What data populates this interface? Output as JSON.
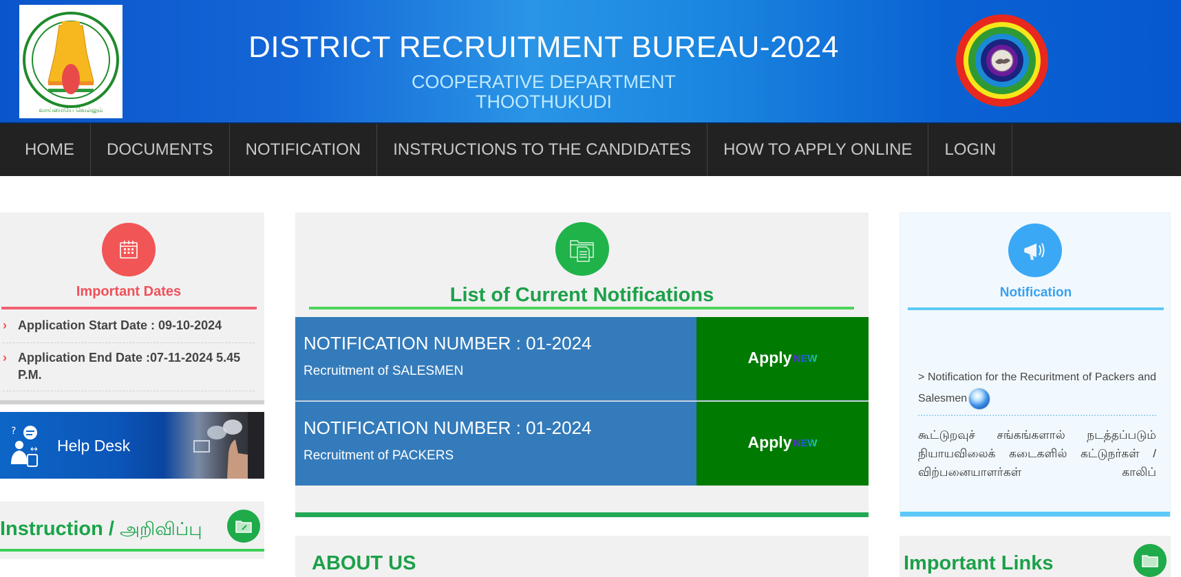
{
  "header": {
    "title": "DISTRICT RECRUITMENT BUREAU-2024",
    "department": "COOPERATIVE DEPARTMENT",
    "district": "THOOTHUKUDI",
    "left_logo": "tamil-nadu-emblem",
    "right_logo": "cooperative-rainbow-logo"
  },
  "nav": {
    "items": [
      {
        "label": "HOME"
      },
      {
        "label": "DOCUMENTS"
      },
      {
        "label": "NOTIFICATION"
      },
      {
        "label": "INSTRUCTIONS TO THE CANDIDATES"
      },
      {
        "label": "HOW TO APPLY ONLINE"
      },
      {
        "label": "LOGIN"
      }
    ]
  },
  "important_dates": {
    "icon": "calendar-icon",
    "title": "Important Dates",
    "items": [
      {
        "text": "Application Start Date : 09-10-2024"
      },
      {
        "text": "Application End Date :07-11-2024 5.45 P.M."
      }
    ],
    "bullet": "›"
  },
  "helpdesk": {
    "label": "Help Desk"
  },
  "instruction": {
    "title": "Instruction / ",
    "title_tamil": "அறிவிப்பு",
    "icon": "folder-icon"
  },
  "notifications": {
    "icon": "folder-document-icon",
    "title": "List of Current Notifications",
    "rows": [
      {
        "number": "NOTIFICATION NUMBER : 01-2024",
        "description": "Recruitment of SALESMEN",
        "apply_label": "Apply",
        "badge": "NEW"
      },
      {
        "number": "NOTIFICATION NUMBER : 01-2024",
        "description": "Recruitment of PACKERS",
        "apply_label": "Apply",
        "badge": "NEW"
      }
    ]
  },
  "about": {
    "title": "ABOUT US"
  },
  "right_notification": {
    "icon": "megaphone-icon",
    "title": "Notification",
    "link_text": "> Notification for the Recuritment of Packers and Salesmen",
    "tamil_text": "கூட்டுறவுச் சங்கங்களால் நடத்தப்படும் நியாயவிலைக் கடைகளில் கட்டுநர்கள் / விற்பனையாளர்கள் காலிப்"
  },
  "important_links": {
    "title": "Important Links",
    "icon": "folder-icon"
  },
  "colors": {
    "header_blue": "#0a55cc",
    "nav_bg": "#222222",
    "dates_red": "#f25555",
    "green": "#1fb34a",
    "notif_blue": "#347bbb",
    "apply_green": "#007a00",
    "sky_blue": "#3aa8f5"
  }
}
